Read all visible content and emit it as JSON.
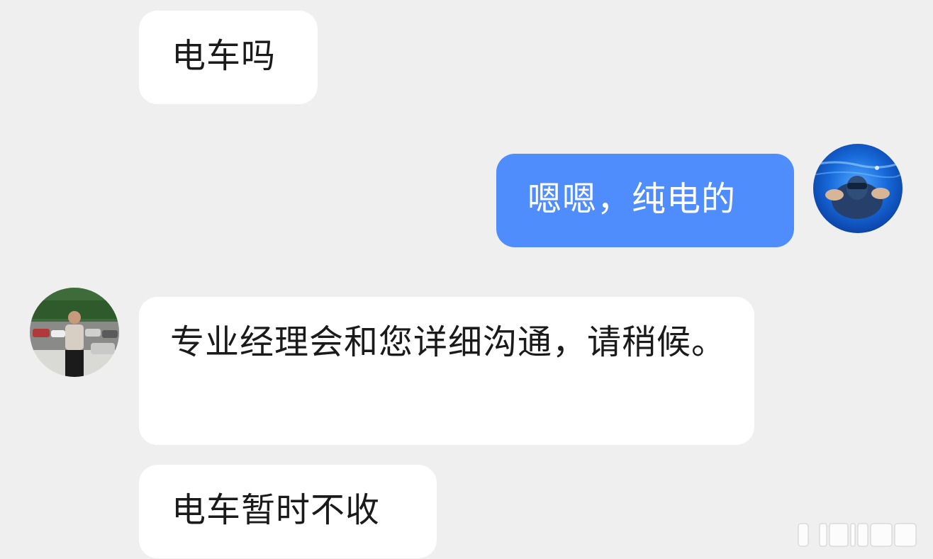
{
  "chat": {
    "messages": [
      {
        "sender": "other",
        "text": "电车吗"
      },
      {
        "sender": "me",
        "text": "嗯嗯，纯电的"
      },
      {
        "sender": "other",
        "text": "专业经理会和您详细沟通，请稍候。"
      },
      {
        "sender": "other",
        "text": "电车暂时不收"
      }
    ]
  },
  "colors": {
    "background": "#efeff0",
    "incoming_bubble": "#ffffff",
    "outgoing_bubble": "#4f8dfd",
    "incoming_text": "#1a1a1a",
    "outgoing_text": "#ffffff"
  },
  "icons": {
    "my_avatar": "swimmer-underwater-photo",
    "dealer_avatar": "man-in-car-lot-photo"
  }
}
